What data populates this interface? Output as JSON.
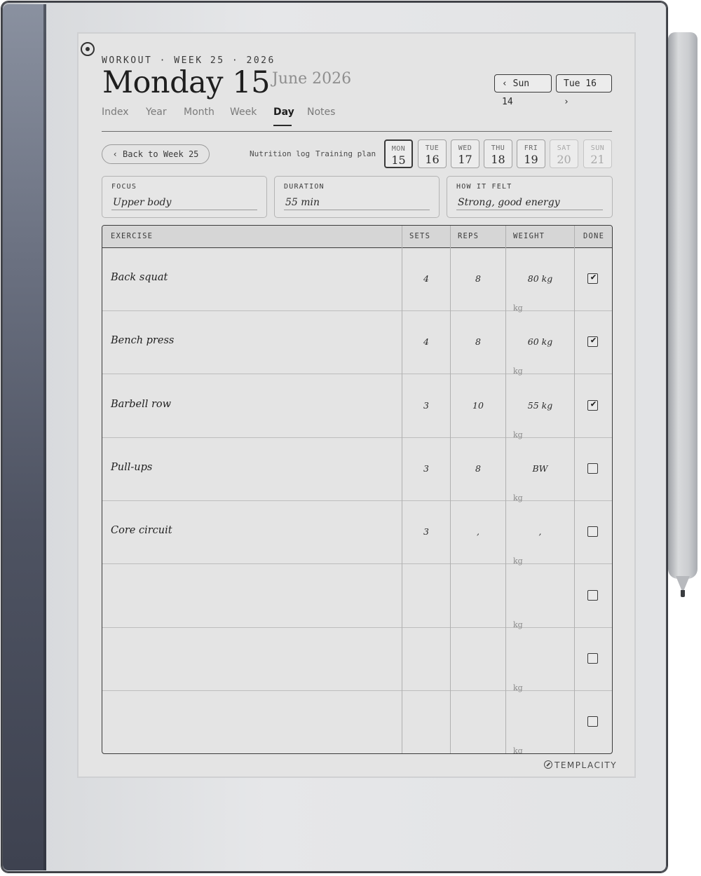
{
  "header": {
    "kicker": "WORKOUT · WEEK 25 · 2026",
    "title": "Monday 15",
    "month": "June 2026",
    "prev_day": "‹ Sun 14",
    "next_day": "Tue 16 ›"
  },
  "tabs": [
    {
      "label": "Index"
    },
    {
      "label": "Year"
    },
    {
      "label": "Month"
    },
    {
      "label": "Week"
    },
    {
      "label": "Day",
      "active": true
    },
    {
      "label": "Notes"
    }
  ],
  "back_link": "‹ Back to Week 25",
  "links": {
    "nutrition": "Nutrition log",
    "training": "Training plan"
  },
  "week_days": [
    {
      "name": "MON",
      "num": "15",
      "selected": true
    },
    {
      "name": "TUE",
      "num": "16"
    },
    {
      "name": "WED",
      "num": "17"
    },
    {
      "name": "THU",
      "num": "18"
    },
    {
      "name": "FRI",
      "num": "19"
    },
    {
      "name": "SAT",
      "num": "20",
      "weekend": true
    },
    {
      "name": "SUN",
      "num": "21",
      "weekend": true
    }
  ],
  "meta": {
    "focus": {
      "label": "FOCUS",
      "value": "Upper body"
    },
    "duration": {
      "label": "DURATION",
      "value": "55 min"
    },
    "felt": {
      "label": "HOW IT FELT",
      "value": "Strong, good energy"
    }
  },
  "table": {
    "headers": {
      "exercise": "EXERCISE",
      "sets": "SETS",
      "reps": "REPS",
      "weight": "WEIGHT",
      "done": "DONE"
    },
    "unit": "kg",
    "rows": [
      {
        "exercise": "Back squat",
        "sets": "4",
        "reps": "8",
        "weight": "80 kg",
        "done": true
      },
      {
        "exercise": "Bench press",
        "sets": "4",
        "reps": "8",
        "weight": "60 kg",
        "done": true
      },
      {
        "exercise": "Barbell row",
        "sets": "3",
        "reps": "10",
        "weight": "55 kg",
        "done": true
      },
      {
        "exercise": "Pull-ups",
        "sets": "3",
        "reps": "8",
        "weight": "BW",
        "done": false
      },
      {
        "exercise": "Core circuit",
        "sets": "3",
        "reps": ",",
        "weight": ",",
        "done": false
      },
      {
        "exercise": "",
        "sets": "",
        "reps": "",
        "weight": "",
        "done": false
      },
      {
        "exercise": "",
        "sets": "",
        "reps": "",
        "weight": "",
        "done": false
      },
      {
        "exercise": "",
        "sets": "",
        "reps": "",
        "weight": "",
        "done": false
      }
    ]
  },
  "brand": "TEMPLACITY"
}
